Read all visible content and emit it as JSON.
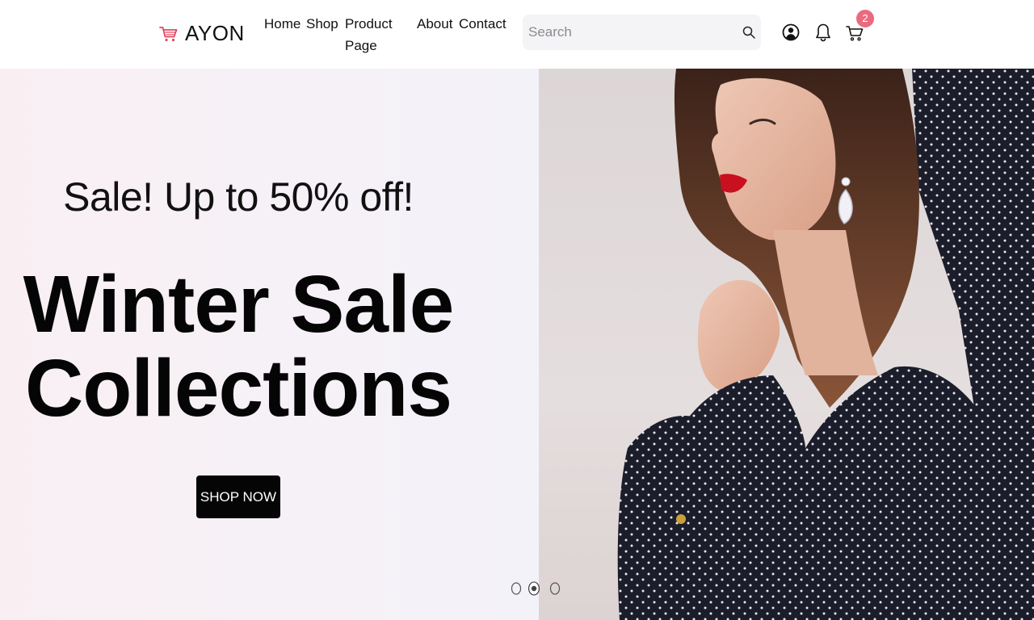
{
  "header": {
    "brand": "AYON",
    "nav": [
      "Home",
      "Shop",
      "Product Page",
      "About",
      "Contact"
    ],
    "search_placeholder": "Search",
    "cart_count": "2"
  },
  "hero": {
    "subtitle": "Sale! Up to 50% off!",
    "title_line1": "Winter Sale",
    "title_line2": "Collections",
    "cta": "SHOP NOW",
    "carousel": {
      "slides": 3,
      "active": 2
    }
  },
  "colors": {
    "accent": "#ea6a7e",
    "brand_icon": "#e0465d",
    "button": "#050505",
    "search_bg": "#f4f4f6"
  },
  "icons": [
    "cart-logo-icon",
    "search-icon",
    "user-icon",
    "bell-icon",
    "cart-icon"
  ]
}
